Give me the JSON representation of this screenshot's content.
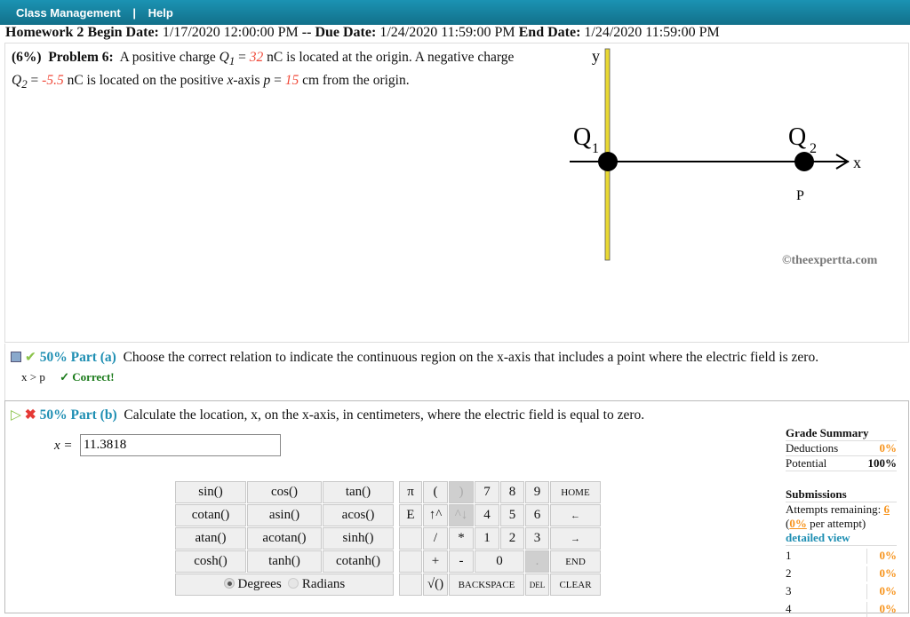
{
  "topbar": {
    "class_management": "Class Management",
    "sep": "|",
    "help": "Help"
  },
  "header": {
    "title": "Homework 2",
    "begin_label": "Begin Date:",
    "begin": "1/17/2020 12:00:00 PM",
    "sep": "--",
    "due_label": "Due Date:",
    "due": "1/24/2020 11:59:00 PM",
    "end_label": "End Date:",
    "end": "1/24/2020 11:59:00 PM"
  },
  "problem": {
    "weight": "(6%)",
    "label": "Problem 6:",
    "t1": "A positive charge",
    "q1": "Q",
    "q1sub": "1",
    "eq": "=",
    "q1val": "32",
    "t2": "nC is located at the origin. A negative charge",
    "q2": "Q",
    "q2sub": "2",
    "q2val": "-5.5",
    "t3": "nC is located on the positive",
    "xvar": "x",
    "t4": "-axis",
    "pvar": "p",
    "pval": "15",
    "t5": "cm from the origin."
  },
  "figure": {
    "y_label": "y",
    "x_label": "x",
    "q1_label": "Q",
    "q1_sub": "1",
    "q2_label": "Q",
    "q2_sub": "2",
    "p_label": "P",
    "watermark": "©theexpertta.com"
  },
  "part_a": {
    "percent": "50% Part (a)",
    "question": "Choose the correct relation to indicate the continuous region on the x-axis that includes a point where the electric field is zero.",
    "answer": "x > p",
    "status": "✓ Correct!"
  },
  "part_b": {
    "percent": "50% Part (b)",
    "question": "Calculate the location, x, on the x-axis, in centimeters, where the electric field is equal to zero.",
    "input_label": "x =",
    "input_value": "11.3818"
  },
  "calculator": {
    "functions": [
      [
        "sin()",
        "cos()",
        "tan()"
      ],
      [
        "cotan()",
        "asin()",
        "acos()"
      ],
      [
        "atan()",
        "acotan()",
        "sinh()"
      ],
      [
        "cosh()",
        "tanh()",
        "cotanh()"
      ]
    ],
    "degrees": "Degrees",
    "radians": "Radians",
    "angle_mode": "Degrees",
    "keys": [
      [
        "π",
        "(",
        ")",
        "7",
        "8",
        "9",
        "HOME"
      ],
      [
        "E",
        "↑^",
        "^↓",
        "4",
        "5",
        "6",
        "←"
      ],
      [
        "",
        "/",
        "*",
        "1",
        "2",
        "3",
        "→"
      ],
      [
        "",
        "+",
        "-",
        "0",
        "",
        ".",
        "END"
      ],
      [
        "",
        "√()",
        "BACKSPACE",
        "",
        "",
        "DEL",
        "CLEAR"
      ]
    ]
  },
  "grade": {
    "title": "Grade Summary",
    "deductions_label": "Deductions",
    "deductions": "0%",
    "potential_label": "Potential",
    "potential": "100%",
    "submissions_title": "Submissions",
    "attempts_label": "Attempts remaining:",
    "attempts": "6",
    "per_open": "(",
    "per_value": "0%",
    "per_close": "per attempt)",
    "detailed": "detailed view",
    "history": [
      {
        "n": "1",
        "v": "0%"
      },
      {
        "n": "2",
        "v": "0%"
      },
      {
        "n": "3",
        "v": "0%"
      },
      {
        "n": "4",
        "v": "0%"
      }
    ]
  }
}
